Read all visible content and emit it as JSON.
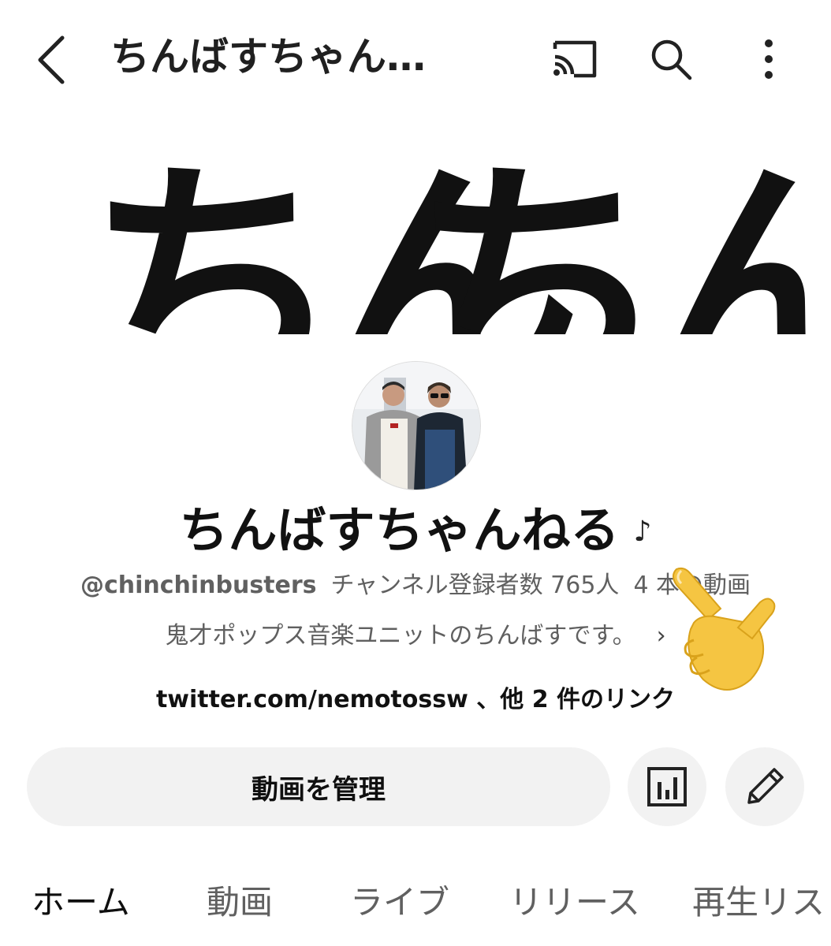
{
  "header": {
    "title": "ちんばすちゃん…",
    "icons": {
      "back": "chevron-left-icon",
      "cast": "cast-icon",
      "search": "search-icon",
      "more": "more-vertical-icon"
    }
  },
  "banner": {
    "text_left": "ちん",
    "text_right": "ちん"
  },
  "channel": {
    "name": "ちんばすちゃんねる",
    "note_glyph": "♪",
    "handle": "@chinchinbusters",
    "subscribers": "チャンネル登録者数 765人",
    "videos": "4 本の動画",
    "description": "鬼才ポップス音楽ユニットのちんばすです。",
    "description_chevron": "›",
    "links": "twitter.com/nemotossw 、他 2 件のリンク"
  },
  "actions": {
    "manage_label": "動画を管理",
    "analytics_icon": "analytics-icon",
    "edit_icon": "pencil-icon"
  },
  "tabs": [
    {
      "label": "ホーム",
      "active": true
    },
    {
      "label": "動画",
      "active": false
    },
    {
      "label": "ライブ",
      "active": false
    },
    {
      "label": "リリース",
      "active": false
    },
    {
      "label": "再生リス",
      "active": false
    }
  ],
  "colors": {
    "text_primary": "#0f0f0f",
    "text_secondary": "#606060",
    "button_bg": "#f2f2f2",
    "hand_emoji": "#f5c542"
  }
}
